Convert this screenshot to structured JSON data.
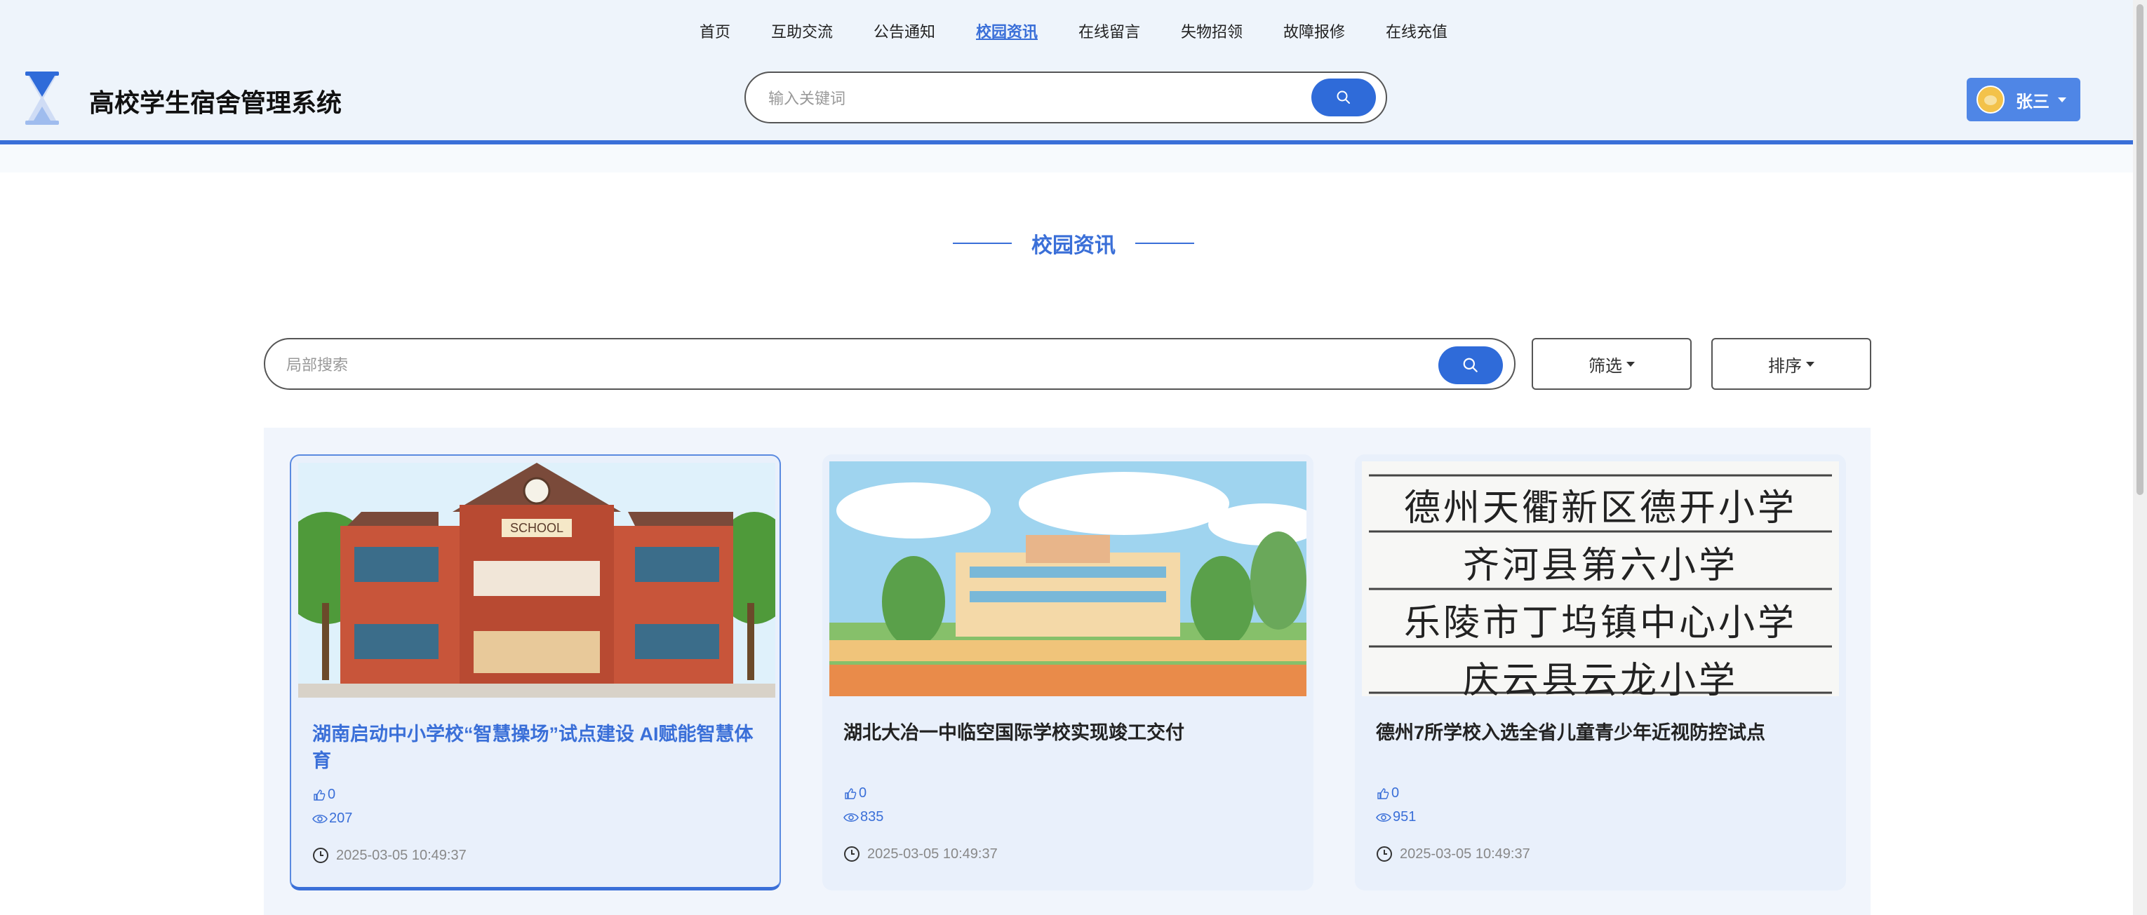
{
  "nav": {
    "items": [
      {
        "label": "首页",
        "active": false
      },
      {
        "label": "互助交流",
        "active": false
      },
      {
        "label": "公告通知",
        "active": false
      },
      {
        "label": "校园资讯",
        "active": true
      },
      {
        "label": "在线留言",
        "active": false
      },
      {
        "label": "失物招领",
        "active": false
      },
      {
        "label": "故障报修",
        "active": false
      },
      {
        "label": "在线充值",
        "active": false
      }
    ]
  },
  "header": {
    "site_title": "高校学生宿舍管理系统",
    "search_placeholder": "输入关键词",
    "user_name": "张三"
  },
  "section": {
    "title": "校园资讯"
  },
  "toolbar": {
    "local_search_placeholder": "局部搜索",
    "filter_label": "筛选",
    "sort_label": "排序"
  },
  "cards": [
    {
      "title": "湖南启动中小学校“智慧操场”试点建设 AI赋能智慧体育",
      "likes": "0",
      "views": "207",
      "date": "2025-03-05 10:49:37",
      "image": "school-building-illustration",
      "active": true
    },
    {
      "title": "湖北大冶一中临空国际学校实现竣工交付",
      "likes": "0",
      "views": "835",
      "date": "2025-03-05 10:49:37",
      "image": "campus-landscape-illustration",
      "active": false
    },
    {
      "title": "德州7所学校入选全省儿童青少年近视防控试点",
      "likes": "0",
      "views": "951",
      "date": "2025-03-05 10:49:37",
      "image": "school-name-list-photo",
      "active": false,
      "image_text": [
        "德州天衢新区德开小学",
        "齐河县第六小学",
        "乐陵市丁坞镇中心小学",
        "庆云县云龙小学"
      ]
    }
  ],
  "colors": {
    "accent": "#3a6fd8",
    "header_bg": "#eef4fb",
    "card_bg": "#e9f0fb",
    "user_button": "#4f86e6"
  }
}
